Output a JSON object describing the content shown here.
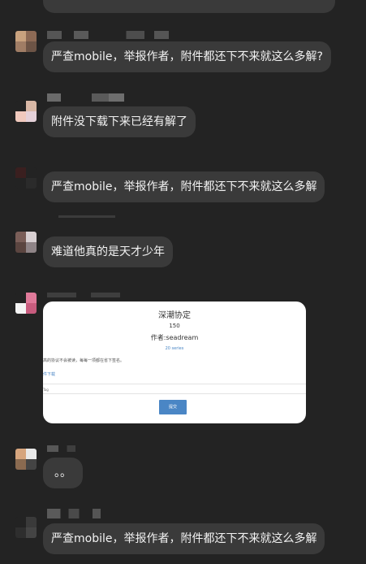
{
  "messages": [
    {
      "text": "严查mobile，举报作者，附件都还下不来就这么多解?"
    },
    {
      "text": "附件没下载下来已经有解了"
    },
    {
      "text": "严查mobile，举报作者，附件都还下不来就这么多解"
    },
    {
      "text": "难道他真的是天才少年"
    },
    {
      "text": "。。"
    },
    {
      "text": "严查mobile，举报作者，附件都还下不来就这么多解"
    }
  ],
  "card": {
    "title": "深潮协定",
    "version": "150",
    "author": "作者:seadream",
    "series": "20 series",
    "desc": "高的协议不会被读，每每一项都在省下签名。",
    "download": "件下载",
    "tag": "Tag",
    "submit": "提交"
  },
  "colors": {
    "background": "#232323",
    "bubble": "#3a3a3a",
    "bubble_text": "#f2f2f2",
    "card_link": "#4a86c5"
  }
}
